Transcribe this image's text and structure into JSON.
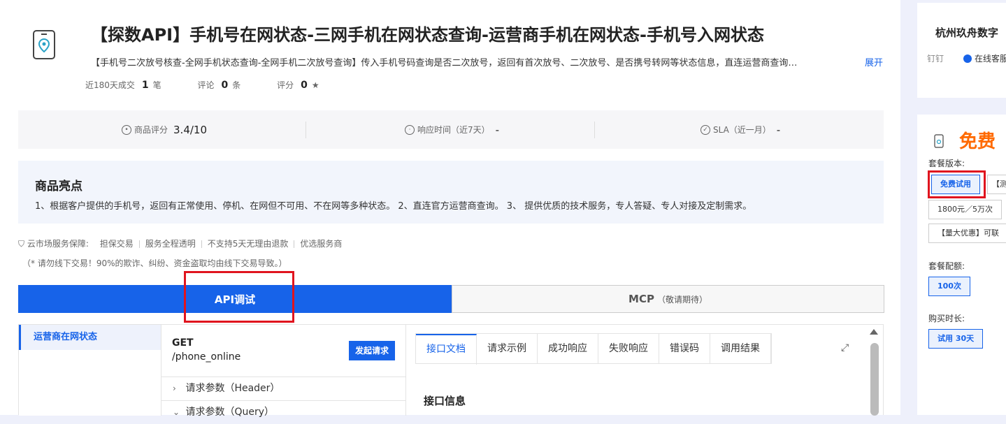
{
  "product": {
    "title": "【探数API】手机号在网状态-三网手机在网状态查询-运营商手机在网状态-手机号入网状态",
    "description": "【手机号二次放号核查-全网手机状态查询-全网手机二次放号查询】传入手机号码查询是否二次放号，返回有首次放号、二次放号、是否携号转网等状态信息，直连运营商查询…",
    "expand_label": "展开",
    "stats": {
      "deals_label": "近180天成交",
      "deals_value": "1",
      "deals_unit": "笔",
      "reviews_label": "评论",
      "reviews_value": "0",
      "reviews_unit": "条",
      "rating_label": "评分",
      "rating_value": "0",
      "rating_unit": "★"
    }
  },
  "metrics": [
    {
      "label": "商品评分",
      "value": "3.4/10"
    },
    {
      "label": "响应时间（近7天）",
      "value": "-"
    },
    {
      "label": "SLA（近一月）",
      "value": "-"
    }
  ],
  "highlights": {
    "title": "商品亮点",
    "text": "1、根据客户提供的手机号，返回有正常使用、停机、在网但不可用、不在网等多种状态。 2、直连官方运营商查询。 3、 提供优质的技术服务，专人答疑、专人对接及定制需求。"
  },
  "guarantee": {
    "label": "云市场服务保障:",
    "items": [
      "担保交易",
      "服务全程透明",
      "不支持5天无理由退款",
      "优选服务商"
    ],
    "warning": "（* 请勿线下交易！90%的欺诈、纠纷、资金盗取均由线下交易导致。）"
  },
  "main_tabs": {
    "api": "API调试",
    "mcp": "MCP",
    "mcp_note": "（敬请期待）"
  },
  "api_list": [
    "运营商在网状态"
  ],
  "request": {
    "method": "GET",
    "path": "/phone_online",
    "send_label": "发起请求",
    "params": [
      "请求参数（Header）",
      "请求参数（Query）"
    ]
  },
  "doc_tabs": [
    "接口文档",
    "请求示例",
    "成功响应",
    "失败响应",
    "错误码",
    "调用结果"
  ],
  "doc_heading": "接口信息",
  "seller": {
    "company": "杭州玖舟数字",
    "dingtalk_label": "钉钉",
    "online_service": "在线客服"
  },
  "purchase": {
    "price": "免费",
    "version_label": "套餐版本:",
    "versions": [
      "免费试用",
      "【测",
      "1800元／5万次",
      "【量大优惠】可联"
    ],
    "quota_label": "套餐配额:",
    "quota": "100次",
    "duration_label": "购买时长:",
    "duration": "试用 30天"
  },
  "colors": {
    "accent": "#1763e9",
    "price": "#ff6a00",
    "highlight_box": "#e0141e"
  }
}
